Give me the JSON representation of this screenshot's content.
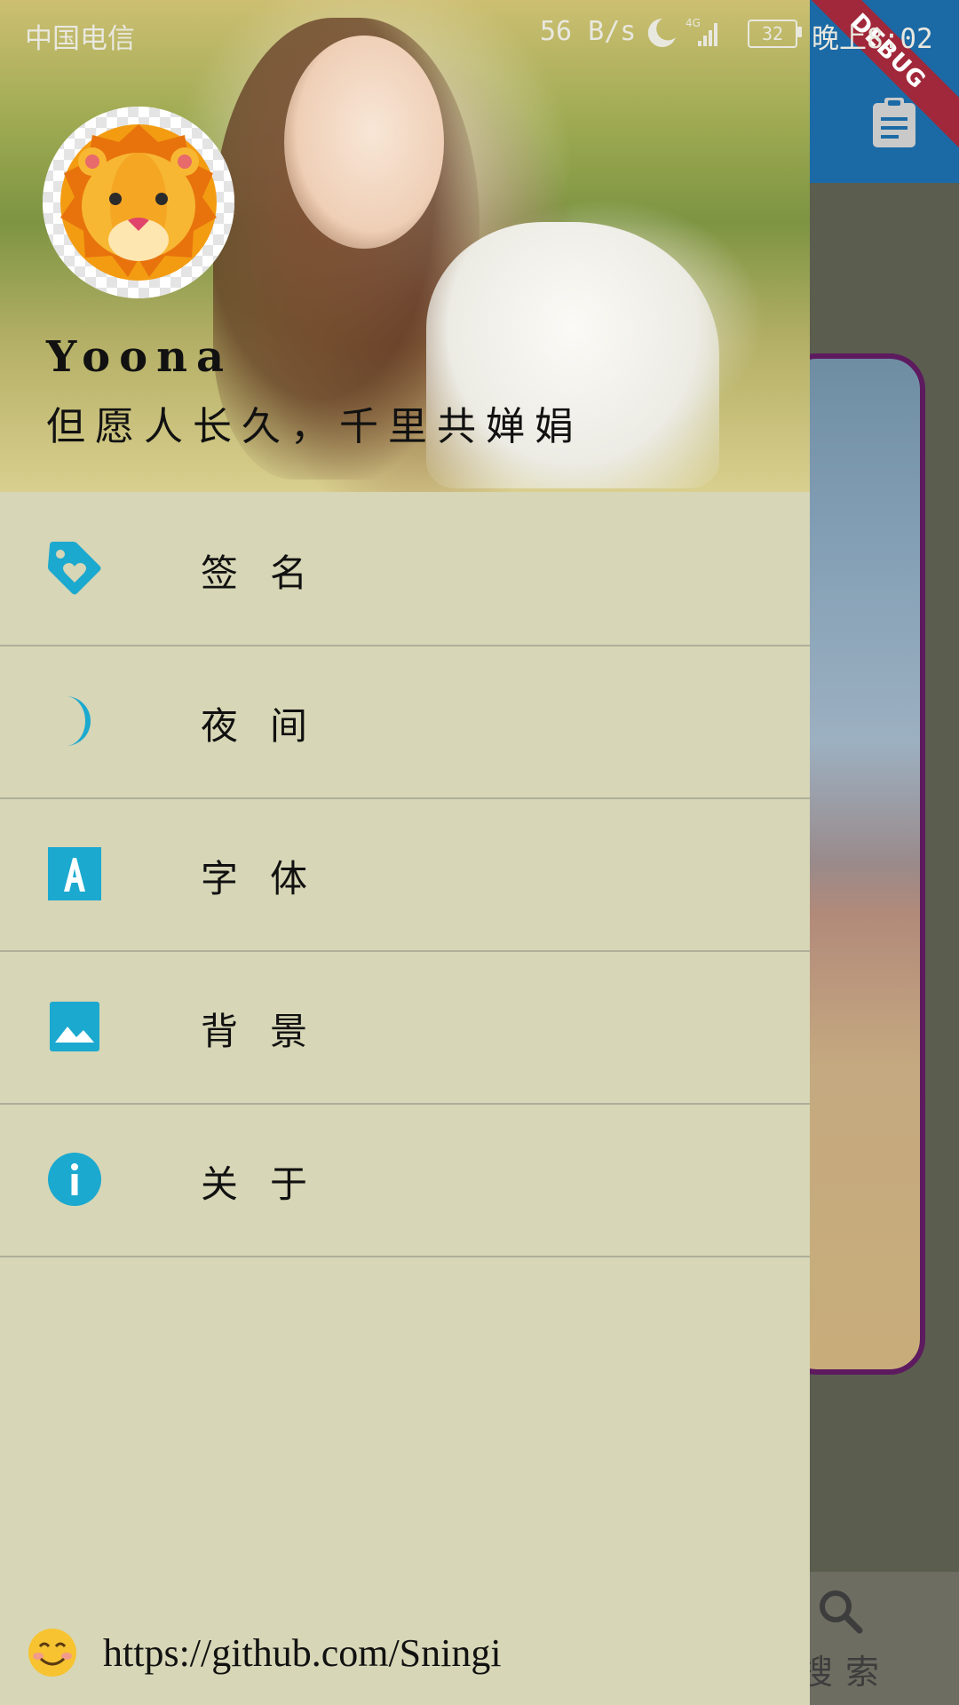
{
  "status_bar": {
    "carrier": "中国电信",
    "net_speed": "56 B/s",
    "network": "4G",
    "battery": "32",
    "time": "晚上8:02"
  },
  "debug_banner": "DEBUG",
  "drawer": {
    "header": {
      "user_name": "Yoona",
      "motto": "但愿人长久，千里共婵娟"
    },
    "menu": [
      {
        "label": "签名",
        "icon": "tag-heart-icon"
      },
      {
        "label": "夜间",
        "icon": "moon-icon"
      },
      {
        "label": "字体",
        "icon": "font-icon"
      },
      {
        "label": "背景",
        "icon": "image-icon"
      },
      {
        "label": "关于",
        "icon": "info-icon"
      }
    ],
    "footer": {
      "emoji": "😊",
      "link": "https://github.com/Sningi"
    }
  },
  "background_app": {
    "search_label": "搜索"
  },
  "colors": {
    "accent": "#1BA9CF",
    "drawer_bg": "#D7D6B6",
    "appbar": "#1B6AA6",
    "card_border": "#5D1A5F"
  }
}
